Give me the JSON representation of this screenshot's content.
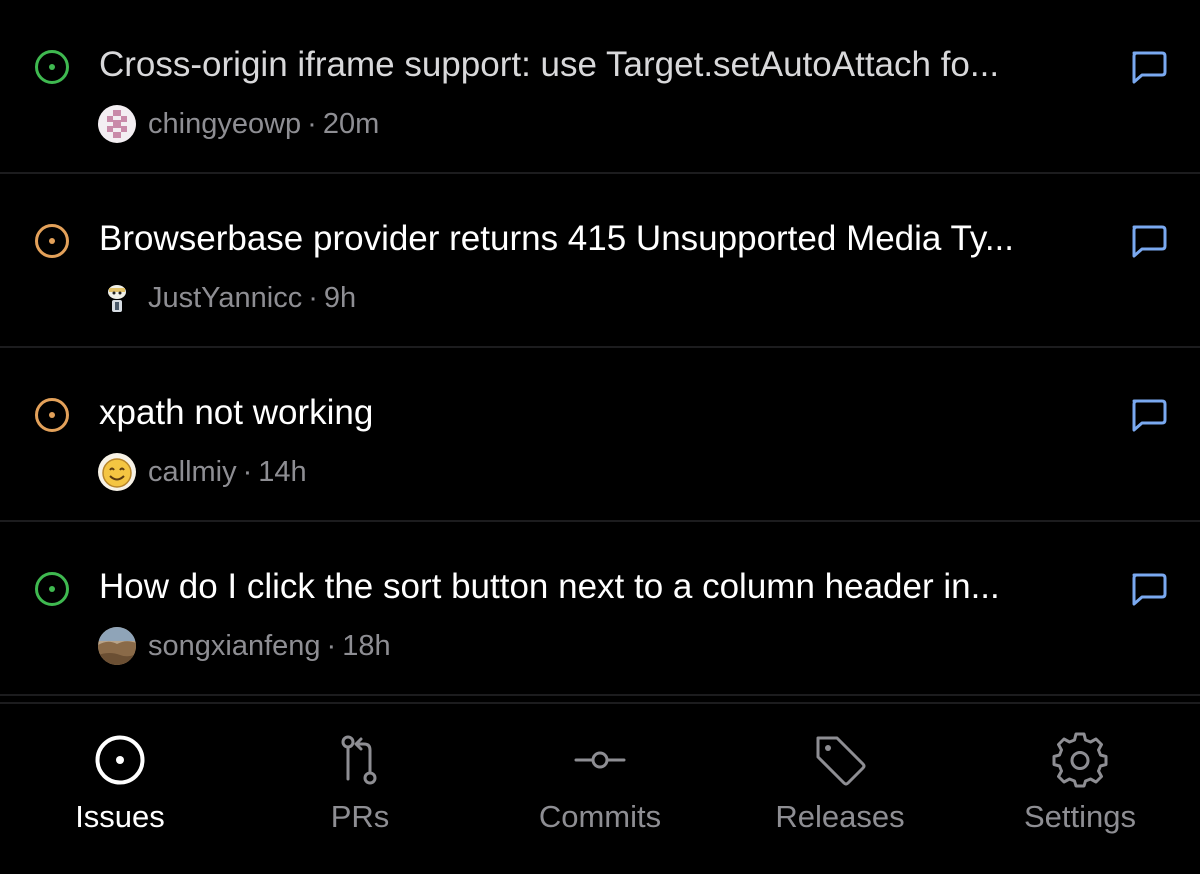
{
  "colors": {
    "open_green": "#3fb950",
    "open_orange": "#e3a15a",
    "comment_blue": "#7aa9f0",
    "muted": "#8e8e93",
    "active": "#ffffff"
  },
  "issues": [
    {
      "title": "Cross-origin iframe support: use Target.setAutoAttach fo...",
      "author": "chingyeowp",
      "time": "20m",
      "status_icon": "issue-open-icon",
      "status_color": "green",
      "avatar": "pixel-pattern-avatar"
    },
    {
      "title": "Browserbase provider returns 415 Unsupported Media Ty...",
      "author": "JustYannicc",
      "time": "9h",
      "status_icon": "issue-open-icon",
      "status_color": "orange",
      "avatar": "character-avatar"
    },
    {
      "title": "xpath not working",
      "author": "callmiy",
      "time": "14h",
      "status_icon": "issue-open-icon",
      "status_color": "orange",
      "avatar": "smiley-avatar"
    },
    {
      "title": "How do I click the sort button next to a column header in...",
      "author": "songxianfeng",
      "time": "18h",
      "status_icon": "issue-open-icon",
      "status_color": "green",
      "avatar": "landscape-avatar"
    }
  ],
  "meta_separator": "·",
  "tabs": [
    {
      "label": "Issues",
      "icon": "issue-circle-icon",
      "active": true
    },
    {
      "label": "PRs",
      "icon": "pull-request-icon",
      "active": false
    },
    {
      "label": "Commits",
      "icon": "commit-icon",
      "active": false
    },
    {
      "label": "Releases",
      "icon": "tag-icon",
      "active": false
    },
    {
      "label": "Settings",
      "icon": "gear-icon",
      "active": false
    }
  ]
}
